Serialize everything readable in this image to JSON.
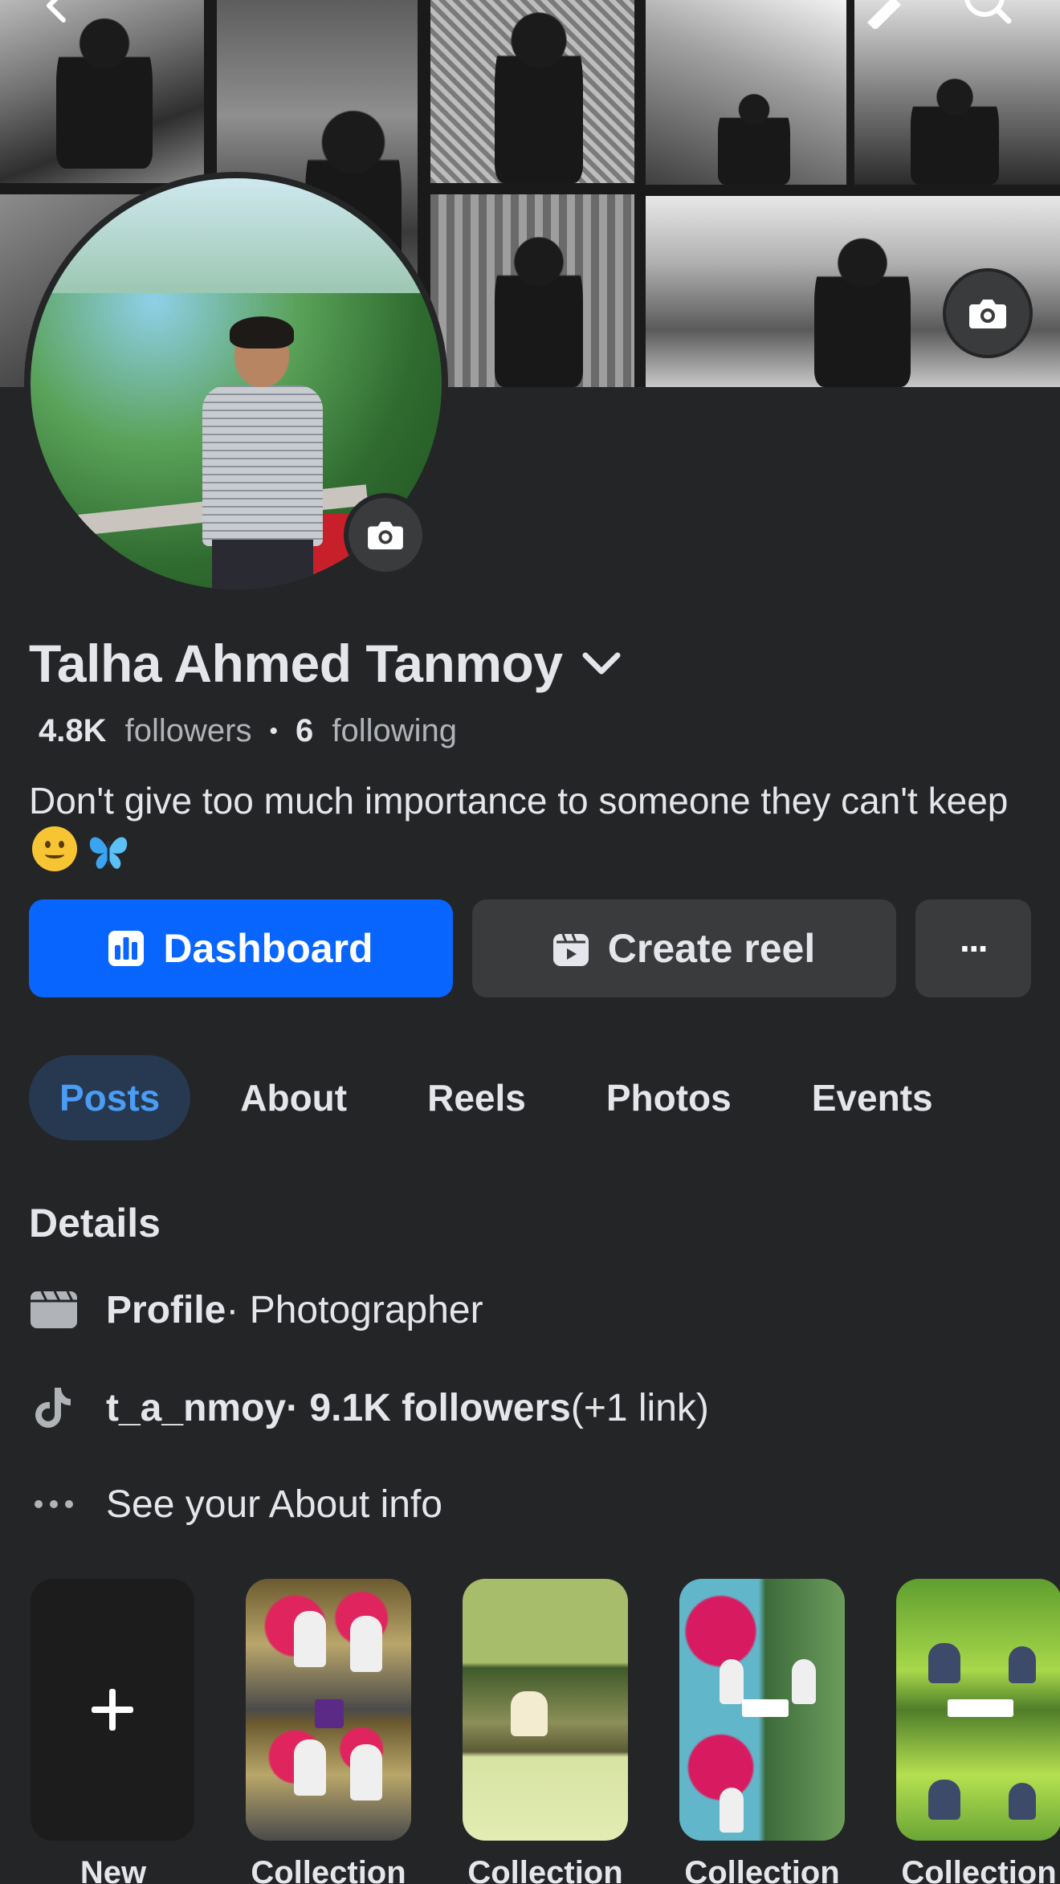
{
  "profile": {
    "name": "Talha Ahmed Tanmoy",
    "followers_count": "4.8K",
    "followers_label": "followers",
    "following_count": "6",
    "following_label": "following",
    "stats_separator": "•",
    "bio": "Don't give too much importance to someone they can't keep"
  },
  "actions": {
    "dashboard": "Dashboard",
    "create_reel": "Create reel",
    "more": "···"
  },
  "tabs": [
    {
      "label": "Posts",
      "active": true
    },
    {
      "label": "About",
      "active": false
    },
    {
      "label": "Reels",
      "active": false
    },
    {
      "label": "Photos",
      "active": false
    },
    {
      "label": "Events",
      "active": false
    }
  ],
  "details": {
    "title": "Details",
    "profile_label": "Profile",
    "profile_value": " · Photographer",
    "tiktok_handle": "t_a_nmoy",
    "tiktok_followers": " · 9.1K followers",
    "tiktok_extra": " (+1 link)",
    "see_about": "See your About info"
  },
  "collections": {
    "new_label": "New",
    "items": [
      "Collection",
      "Collection",
      "Collection",
      "Collection"
    ]
  },
  "icons": {
    "cover_top_left": "back-arrow-icon",
    "cover_top_right": [
      "pencil-icon",
      "search-icon"
    ],
    "camera": "camera-icon",
    "chevron": "chevron-down-icon",
    "dashboard": "bar-chart-icon",
    "reel": "reel-icon",
    "details": [
      "clapperboard-icon",
      "tiktok-icon",
      "more-dots-icon"
    ],
    "new_collection": "plus-icon"
  },
  "colors": {
    "background": "#242526",
    "primary_button": "#0866ff",
    "secondary_button": "#3a3b3c",
    "active_tab_bg": "#263951",
    "active_tab_text": "#4b9cf5",
    "text_primary": "#e4e6eb",
    "text_secondary": "#b0b3b8"
  }
}
